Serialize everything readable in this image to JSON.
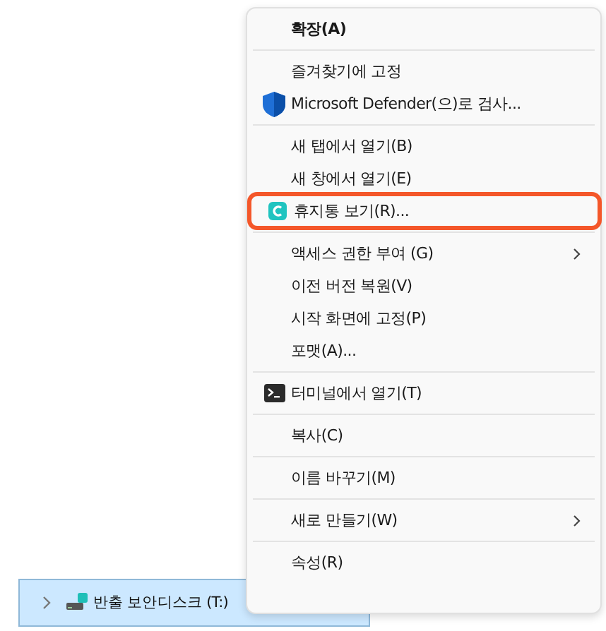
{
  "menu": {
    "entries": [
      {
        "kind": "plain",
        "label": "확장(A)",
        "bold": true,
        "submenu": false,
        "highlighted": false
      },
      {
        "kind": "separator"
      },
      {
        "kind": "plain",
        "label": "즐겨찾기에 고정",
        "bold": false,
        "submenu": false,
        "highlighted": false
      },
      {
        "kind": "shield",
        "label": "Microsoft Defender(으)로 검사...",
        "bold": false,
        "submenu": false,
        "highlighted": false
      },
      {
        "kind": "separator"
      },
      {
        "kind": "plain",
        "label": "새 탭에서 열기(B)",
        "bold": false,
        "submenu": false,
        "highlighted": false
      },
      {
        "kind": "plain",
        "label": "새 창에서 열기(E)",
        "bold": false,
        "submenu": false,
        "highlighted": false
      },
      {
        "kind": "app",
        "label": "휴지통 보기(R)...",
        "bold": false,
        "submenu": false,
        "highlighted": true
      },
      {
        "kind": "separator"
      },
      {
        "kind": "plain",
        "label": "액세스 권한 부여 (G)",
        "bold": false,
        "submenu": true,
        "highlighted": false
      },
      {
        "kind": "plain",
        "label": "이전 버전 복원(V)",
        "bold": false,
        "submenu": false,
        "highlighted": false
      },
      {
        "kind": "plain",
        "label": "시작 화면에 고정(P)",
        "bold": false,
        "submenu": false,
        "highlighted": false
      },
      {
        "kind": "plain",
        "label": "포맷(A)...",
        "bold": false,
        "submenu": false,
        "highlighted": false
      },
      {
        "kind": "separator"
      },
      {
        "kind": "terminal",
        "label": "터미널에서 열기(T)",
        "bold": false,
        "submenu": false,
        "highlighted": false
      },
      {
        "kind": "separator"
      },
      {
        "kind": "plain",
        "label": "복사(C)",
        "bold": false,
        "submenu": false,
        "highlighted": false
      },
      {
        "kind": "separator"
      },
      {
        "kind": "plain",
        "label": "이름 바꾸기(M)",
        "bold": false,
        "submenu": false,
        "highlighted": false
      },
      {
        "kind": "separator"
      },
      {
        "kind": "plain",
        "label": "새로 만들기(W)",
        "bold": false,
        "submenu": true,
        "highlighted": false
      },
      {
        "kind": "separator"
      },
      {
        "kind": "plain",
        "label": "속성(R)",
        "bold": false,
        "submenu": false,
        "highlighted": false
      }
    ]
  },
  "nav_item": {
    "label": "반출 보안디스크 (T:)",
    "selected": true
  }
}
